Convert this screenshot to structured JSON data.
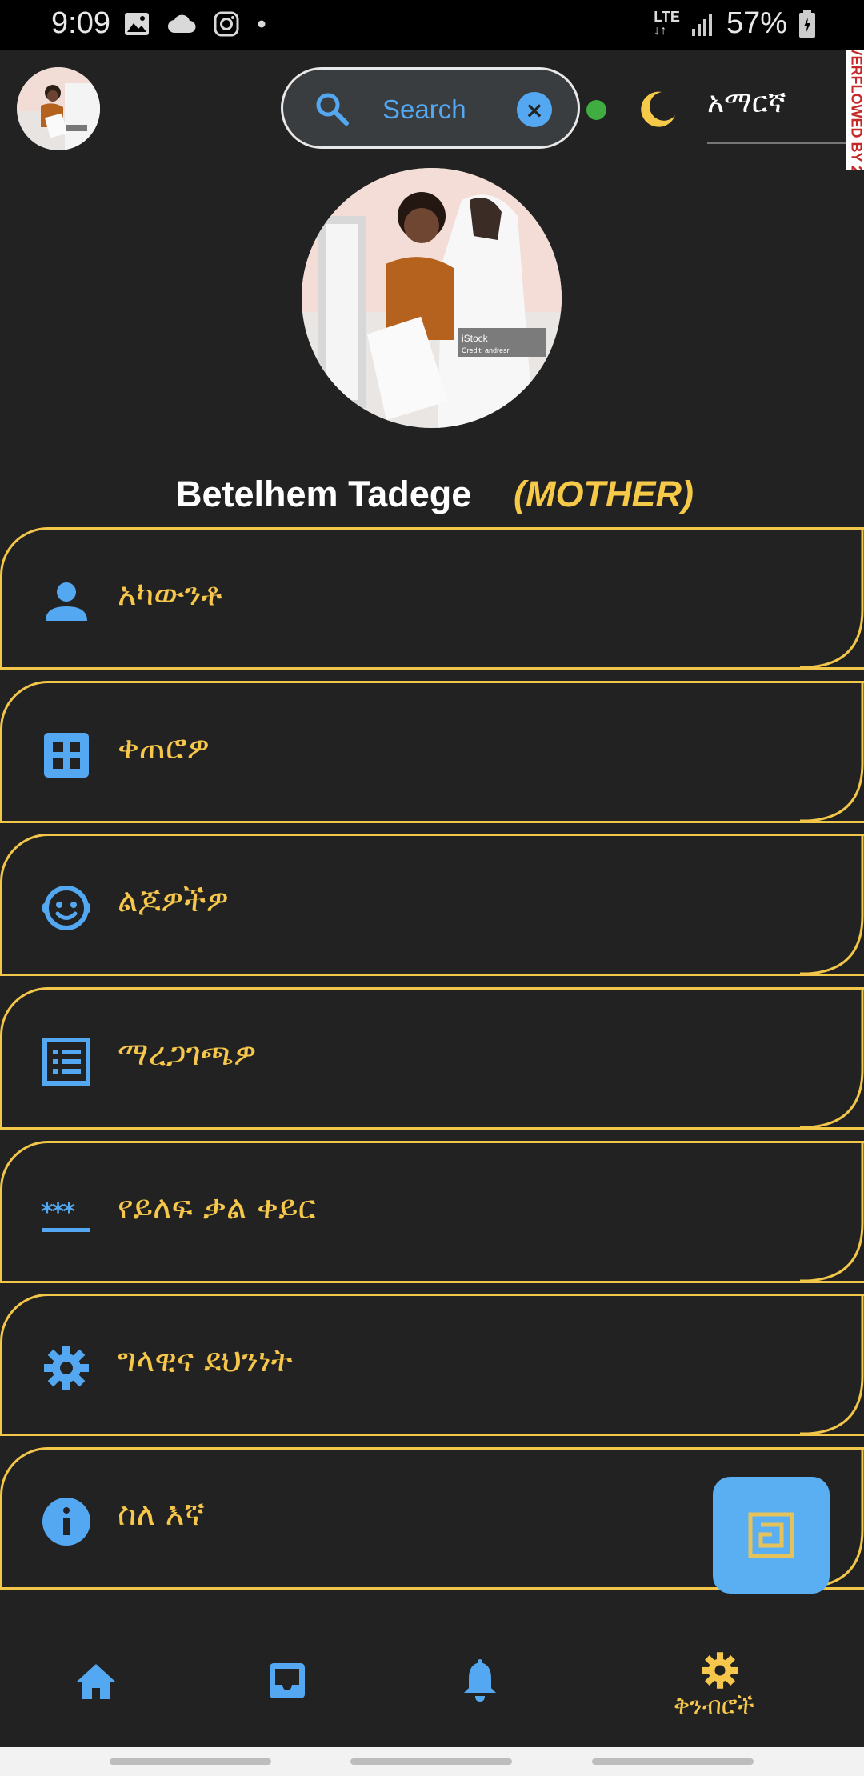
{
  "status_bar": {
    "time": "9:09",
    "network": "LTE",
    "battery": "57%",
    "icons": [
      "gallery-icon",
      "cloud-icon",
      "instagram-icon",
      "dot-icon",
      "signal-icon",
      "battery-icon"
    ]
  },
  "header": {
    "search_placeholder": "Search",
    "clear_icon": "×",
    "online_status_color": "#3fad3f",
    "theme_icon": "moon-icon",
    "language": "አማርኛ",
    "overflow_banner": "VERFLOWED BY 2"
  },
  "profile": {
    "name": "Betelhem Tadege",
    "role": "(MOTHER)"
  },
  "menu": {
    "items": [
      {
        "label": "አካውንቶ",
        "icon": "person-icon"
      },
      {
        "label": "ቀጠሮዎ",
        "icon": "grid-icon"
      },
      {
        "label": "ልጆዎችዎ",
        "icon": "baby-face-icon"
      },
      {
        "label": "ማረጋገጫዎ",
        "icon": "list-icon"
      },
      {
        "label": "የይለፍ ቃል ቀይር",
        "icon": "password-icon"
      },
      {
        "label": "ግላዊና ደህንነት",
        "icon": "gear-icon"
      },
      {
        "label": "ስለ እኛ",
        "icon": "info-icon"
      }
    ]
  },
  "fab": {
    "icon": "qr-frame-icon"
  },
  "bottom_nav": {
    "items": [
      "home-icon",
      "inbox-icon",
      "bell-icon",
      "settings-icon"
    ],
    "settings_label": "ቅንብሮች"
  },
  "colors": {
    "accent_yellow": "#f6c74a",
    "accent_blue": "#54a8f2",
    "background": "#222222"
  }
}
